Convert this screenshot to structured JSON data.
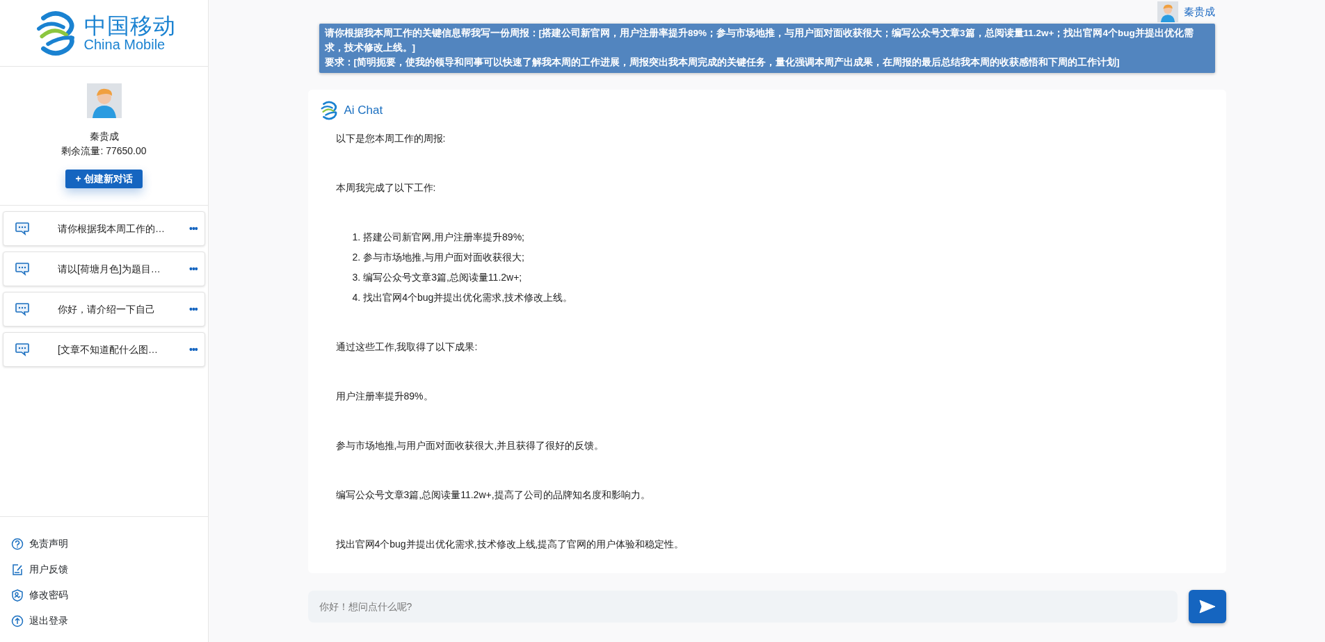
{
  "logo": {
    "name_zh": "中国移动",
    "name_en": "China Mobile"
  },
  "profile": {
    "name": "秦贵成",
    "quota": "剩余流量: 77650.00",
    "new_chat_button": "+ 创建新对话"
  },
  "conversations": [
    {
      "title": "请你根据我本周工作的…",
      "menu": "•••"
    },
    {
      "title": "请以[荷塘月色]为题目…",
      "menu": "•••"
    },
    {
      "title": "你好，请介绍一下自己",
      "menu": "•••"
    },
    {
      "title": "[文章不知道配什么图…",
      "menu": "•••"
    }
  ],
  "footer_links": [
    {
      "kind": "help",
      "label": "免责声明"
    },
    {
      "kind": "feedback",
      "label": "用户反馈"
    },
    {
      "kind": "password",
      "label": "修改密码"
    },
    {
      "kind": "logout",
      "label": "退出登录"
    }
  ],
  "header": {
    "user_name": "秦贵成"
  },
  "user_message": {
    "lines": [
      "请你根据我本周工作的关键信息帮我写一份周报：[搭建公司新官网，用户注册率提升89%；参与市场地推，与用户面对面收获很大；编写公众号文章3篇，总阅读量11.2w+；找出官网4个bug并提出优化需求，技术修改上线。]",
      "要求：[简明扼要，使我的领导和同事可以快速了解我本周的工作进展，周报突出我本周完成的关键任务，量化强调本周产出成果，在周报的最后总结我本周的收获感悟和下周的工作计划]"
    ]
  },
  "reply": {
    "sender": "Ai Chat",
    "blocks": [
      {
        "kind": "paragraph",
        "text": "以下是您本周工作的周报:"
      },
      {
        "kind": "paragraph",
        "text": "本周我完成了以下工作:"
      },
      {
        "kind": "list",
        "items": [
          {
            "number": "1.",
            "text": "搭建公司新官网,用户注册率提升89%;"
          },
          {
            "number": "2.",
            "text": "参与市场地推,与用户面对面收获很大;"
          },
          {
            "number": "3.",
            "text": "编写公众号文章3篇,总阅读量11.2w+;"
          },
          {
            "number": "4.",
            "text": "找出官网4个bug并提出优化需求,技术修改上线。"
          }
        ]
      },
      {
        "kind": "paragraph",
        "text": "通过这些工作,我取得了以下成果:"
      },
      {
        "kind": "paragraph",
        "text": "用户注册率提升89%。"
      },
      {
        "kind": "paragraph",
        "text": "参与市场地推,与用户面对面收获很大,并且获得了很好的反馈。"
      },
      {
        "kind": "paragraph",
        "text": "编写公众号文章3篇,总阅读量11.2w+,提高了公司的品牌知名度和影响力。"
      },
      {
        "kind": "paragraph",
        "text": "找出官网4个bug并提出优化需求,技术修改上线,提高了官网的用户体验和稳定性。"
      }
    ]
  },
  "composer": {
    "placeholder": "你好！想问点什么呢?"
  }
}
